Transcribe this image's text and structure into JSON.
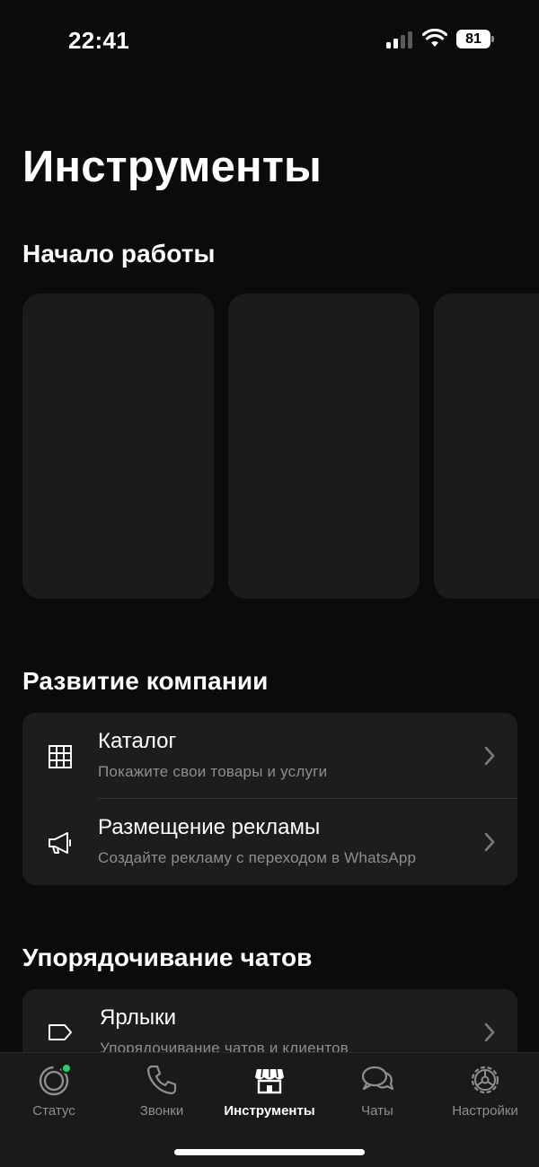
{
  "status_bar": {
    "time": "22:41",
    "battery": "81"
  },
  "page": {
    "title": "Инструменты"
  },
  "sections": {
    "start": {
      "title": "Начало работы"
    },
    "growth": {
      "title": "Развитие компании",
      "items": [
        {
          "title": "Каталог",
          "subtitle": "Покажите свои товары и услуги",
          "icon": "grid-icon"
        },
        {
          "title": "Размещение рекламы",
          "subtitle": "Создайте рекламу с переходом в WhatsApp",
          "icon": "megaphone-icon"
        }
      ]
    },
    "organize": {
      "title": "Упорядочивание чатов",
      "items": [
        {
          "title": "Ярлыки",
          "subtitle": "Упорядочивание чатов и клиентов",
          "icon": "label-icon"
        }
      ]
    }
  },
  "tabs": [
    {
      "label": "Статус",
      "icon": "status-icon",
      "active": false
    },
    {
      "label": "Звонки",
      "icon": "phone-icon",
      "active": false
    },
    {
      "label": "Инструменты",
      "icon": "storefront-icon",
      "active": true
    },
    {
      "label": "Чаты",
      "icon": "chats-icon",
      "active": false
    },
    {
      "label": "Настройки",
      "icon": "settings-icon",
      "active": false
    }
  ],
  "colors": {
    "background": "#0b0b0b",
    "card": "#1b1b1b",
    "group": "#1d1d1e",
    "secondary_text": "#8d8d92",
    "status_dot": "#25d366"
  }
}
